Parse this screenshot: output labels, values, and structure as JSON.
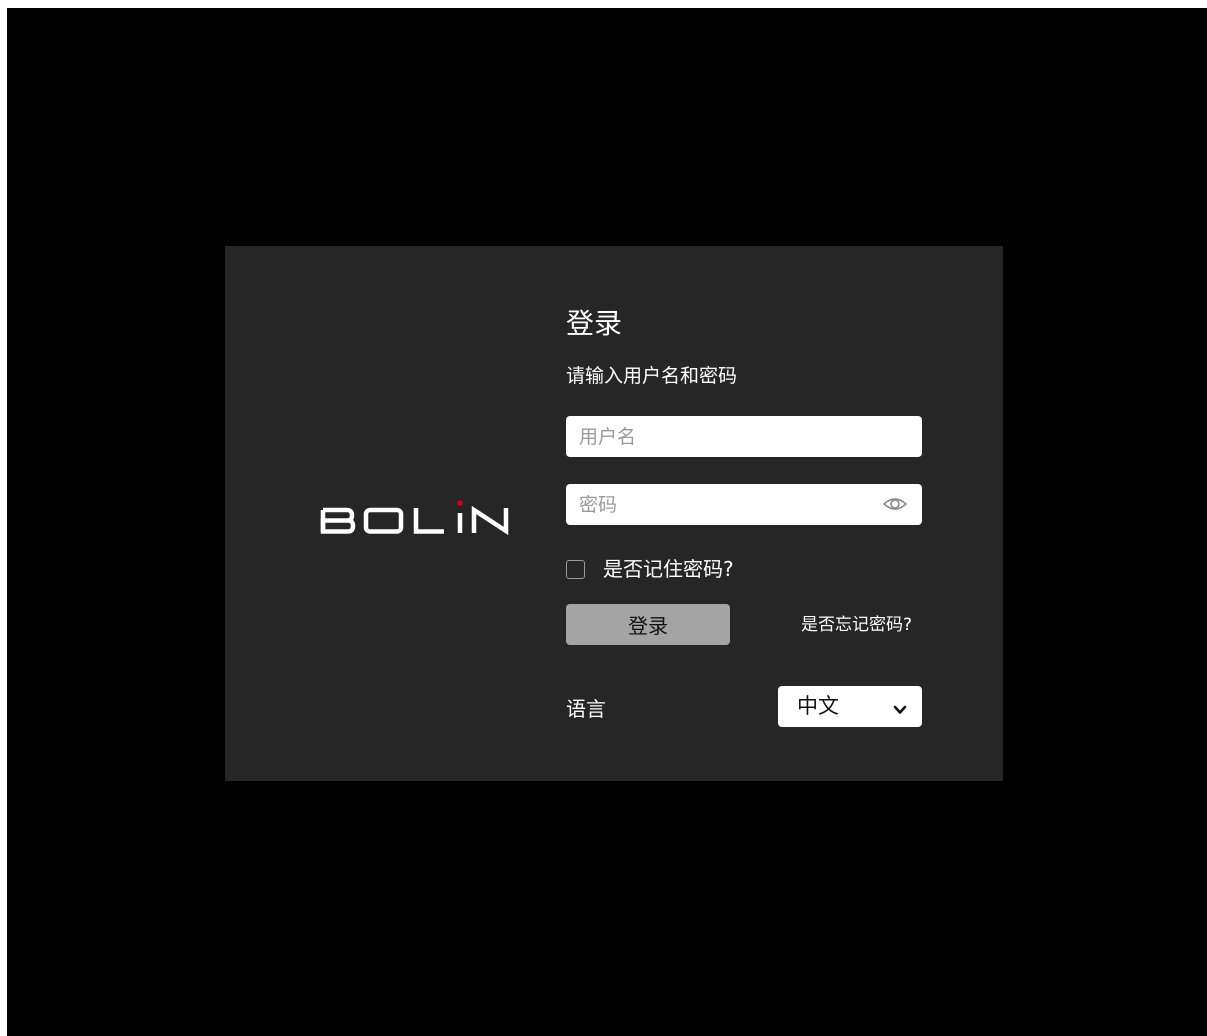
{
  "brand": {
    "logo_text": "BOLIN",
    "logo_dot_color": "#d0021b"
  },
  "login": {
    "title": "登录",
    "subtitle": "请输入用户名和密码",
    "username_placeholder": "用户名",
    "username_value": "",
    "password_placeholder": "密码",
    "password_value": "",
    "password_toggle_icon": "eye-icon",
    "remember_label": "是否记住密码?",
    "remember_checked": false,
    "login_button_label": "登录",
    "forgot_label": "是否忘记密码?"
  },
  "language": {
    "label": "语言",
    "selected": "中文",
    "dropdown_icon": "chevron-down-icon"
  },
  "colors": {
    "background": "#000000",
    "card": "#262626",
    "button": "#a4a4a4",
    "text": "#ffffff"
  }
}
